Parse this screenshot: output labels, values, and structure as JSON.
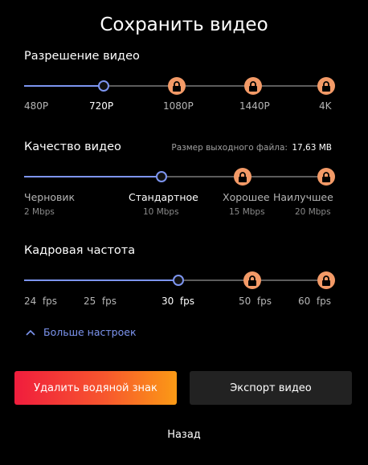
{
  "title": "Сохранить видео",
  "resolution": {
    "label": "Разрешение видео",
    "options": [
      "480P",
      "720P",
      "1080P",
      "1440P",
      "4K"
    ],
    "selected": "720P",
    "locked": [
      "1080P",
      "1440P",
      "4K"
    ]
  },
  "quality": {
    "label": "Качество видео",
    "file_size_label": "Размер выходного файла:",
    "file_size_value": "17,63 MB",
    "options": [
      {
        "name": "Черновик",
        "rate": "2 Mbps"
      },
      {
        "name": "Стандартное",
        "rate": "10 Mbps"
      },
      {
        "name": "Хорошее",
        "rate": "15 Mbps"
      },
      {
        "name": "Наилучшее",
        "rate": "20 Mbps"
      }
    ],
    "selected": "Стандартное",
    "locked": [
      "Хорошее",
      "Наилучшее"
    ]
  },
  "framerate": {
    "label": "Кадровая частота",
    "options": [
      "24  fps",
      "25  fps",
      "30  fps",
      "50  fps",
      "60  fps"
    ],
    "selected": "30  fps",
    "locked": [
      "50  fps",
      "60  fps"
    ]
  },
  "more_settings": {
    "label": "Больше настроек",
    "icon": "chevron-up-icon"
  },
  "buttons": {
    "remove_watermark": "Удалить водяной знак",
    "export": "Экспорт видео",
    "back": "Назад"
  },
  "colors": {
    "accent": "#7d95f0",
    "lock": "#f39a67",
    "gradient_start": "#f01d3d",
    "gradient_end": "#fb9a15",
    "export_bg": "#222222"
  }
}
